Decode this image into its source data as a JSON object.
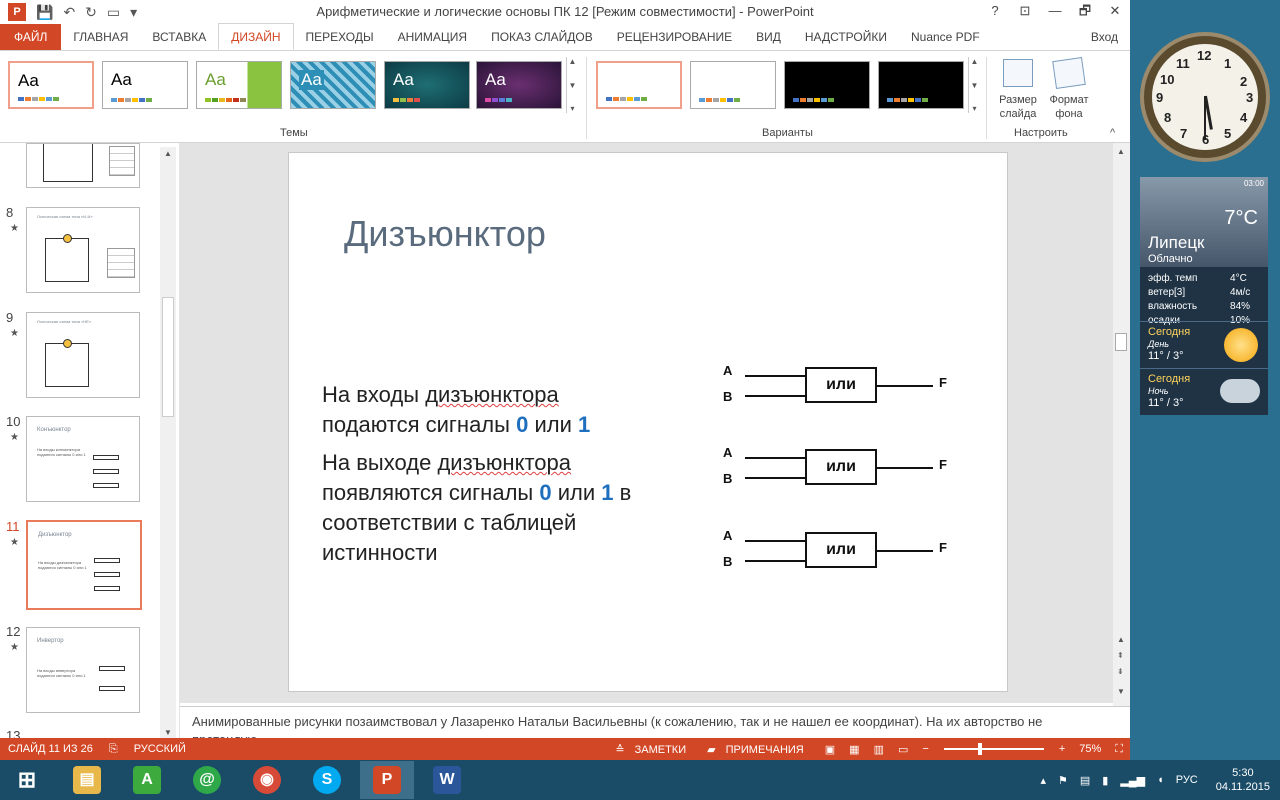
{
  "window": {
    "title": "Арифметические и логические основы ПК 12 [Режим совместимости] - PowerPoint",
    "controls": {
      "help": "?",
      "ribbon_opts": "⊡",
      "minimize": "—",
      "restore": "🗗",
      "close": "✕"
    }
  },
  "tabs": {
    "file": "ФАЙЛ",
    "items": [
      "ГЛАВНАЯ",
      "ВСТАВКА",
      "ДИЗАЙН",
      "ПЕРЕХОДЫ",
      "АНИМАЦИЯ",
      "ПОКАЗ СЛАЙДОВ",
      "РЕЦЕНЗИРОВАНИЕ",
      "ВИД",
      "НАДСТРОЙКИ",
      "Nuance PDF"
    ],
    "active": "ДИЗАЙН",
    "login": "Вход"
  },
  "ribbon": {
    "themes_label": "Темы",
    "variants_label": "Варианты",
    "customize_label": "Настроить",
    "theme_sample": "Aa",
    "slide_size": "Размер слайда",
    "format_background": "Формат фона"
  },
  "thumbnails": [
    {
      "num": "8",
      "title": "Логическая схема типа «И-И»",
      "star": "★"
    },
    {
      "num": "9",
      "title": "Логическая схема типа «НЕ»",
      "star": "★"
    },
    {
      "num": "10",
      "title": "Конъюнктор",
      "star": "★",
      "text": "На входы конъюнктора подаются сигналы 0 или 1"
    },
    {
      "num": "11",
      "title": "Дизъюнктор",
      "star": "★",
      "text": "На входы дизъюнктора подаются сигналы 0 или 1"
    },
    {
      "num": "12",
      "title": "Инвертор",
      "star": "★",
      "text": "На входы инвертора подаются сигналы 0 или 1"
    },
    {
      "num": "13"
    }
  ],
  "slide": {
    "title": "Дизъюнктор",
    "p1_a": "На входы ",
    "p1_word": "дизъюнктора",
    "p1_b": "подаются сигналы ",
    "v0": "0",
    "or": " или ",
    "v1": "1",
    "p2_a": "На выходе ",
    "p2_word": "дизъюнктора",
    "p2_b": "появляются сигналы ",
    "p2_c": " в соответствии с таблицей истинности",
    "gates": [
      {
        "a": "A",
        "b": "B",
        "op": "или",
        "f": "F"
      },
      {
        "a": "A",
        "b": "B",
        "op": "или",
        "f": "F"
      },
      {
        "a": "A",
        "b": "B",
        "op": "или",
        "f": "F"
      }
    ]
  },
  "notes": "Анимированные рисунки позаимствовал у Лазаренко Натальи Васильевны (к сожалению, так и не нашел ее координат). На их авторство не претендую.",
  "status": {
    "slide_counter": "СЛАЙД 11 ИЗ 26",
    "language": "РУССКИЙ",
    "notes_btn": "ЗАМЕТКИ",
    "comments_btn": "ПРИМЕЧАНИЯ",
    "zoom": "75%",
    "zoom_level": 0.34
  },
  "taskbar": {
    "apps": [
      {
        "name": "windows-start",
        "glyph": "⊞",
        "color": "#1a4c68"
      },
      {
        "name": "file-explorer",
        "glyph": "▤",
        "color": "#e8b84a"
      },
      {
        "name": "app-a",
        "glyph": "A",
        "color": "#3caa3c"
      },
      {
        "name": "mail-agent",
        "glyph": "@",
        "color": "#2fa84a"
      },
      {
        "name": "chrome",
        "glyph": "◉",
        "color": "#d84a38"
      },
      {
        "name": "skype",
        "glyph": "S",
        "color": "#00a9f0"
      },
      {
        "name": "powerpoint",
        "glyph": "P",
        "color": "#d24726"
      },
      {
        "name": "word",
        "glyph": "W",
        "color": "#2b579a"
      }
    ],
    "lang": "РУС",
    "time": "5:30",
    "date": "04.11.2015"
  },
  "weather": {
    "time": "03:00",
    "temp": "7°C",
    "city": "Липецк",
    "condition": "Облачно",
    "rows": [
      [
        "эфф. темп",
        "4°C"
      ],
      [
        "ветер[3]",
        "4м/с"
      ],
      [
        "влажность",
        "84%"
      ],
      [
        "осадки",
        "10%"
      ]
    ],
    "day_label": "Сегодня",
    "day_sub": "День",
    "day_temp": "11° /  3°",
    "night_label": "Сегодня",
    "night_sub": "Ночь",
    "night_temp": "11° /  3°"
  },
  "clock_numbers": [
    "12",
    "1",
    "2",
    "3",
    "4",
    "5",
    "6",
    "7",
    "8",
    "9",
    "10",
    "11"
  ]
}
